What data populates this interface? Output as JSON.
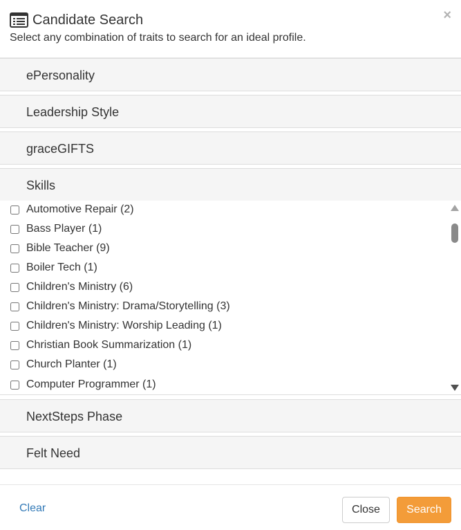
{
  "header": {
    "title": "Candidate Search",
    "subtitle": "Select any combination of traits to search for an ideal profile.",
    "close_symbol": "×",
    "icon": "list-icon"
  },
  "panels": [
    {
      "label": "ePersonality",
      "expanded": false
    },
    {
      "label": "Leadership Style",
      "expanded": false
    },
    {
      "label": "graceGIFTS",
      "expanded": false
    },
    {
      "label": "Skills",
      "expanded": true
    },
    {
      "label": "NextSteps Phase",
      "expanded": false
    },
    {
      "label": "Felt Need",
      "expanded": false
    }
  ],
  "skills": [
    {
      "label": "Automotive Repair (2)",
      "checked": false
    },
    {
      "label": "Bass Player (1)",
      "checked": false
    },
    {
      "label": "Bible Teacher (9)",
      "checked": false
    },
    {
      "label": "Boiler Tech (1)",
      "checked": false
    },
    {
      "label": "Children's Ministry (6)",
      "checked": false
    },
    {
      "label": "Children's Ministry: Drama/Storytelling (3)",
      "checked": false
    },
    {
      "label": "Children's Ministry: Worship Leading (1)",
      "checked": false
    },
    {
      "label": "Christian Book Summarization (1)",
      "checked": false
    },
    {
      "label": "Church Planter (1)",
      "checked": false
    },
    {
      "label": "Computer Programmer (1)",
      "checked": false
    }
  ],
  "footer": {
    "clear_label": "Clear",
    "close_label": "Close",
    "search_label": "Search"
  },
  "colors": {
    "accent": "#f39c39",
    "link": "#337ab7",
    "panel_bg": "#f5f5f5"
  }
}
